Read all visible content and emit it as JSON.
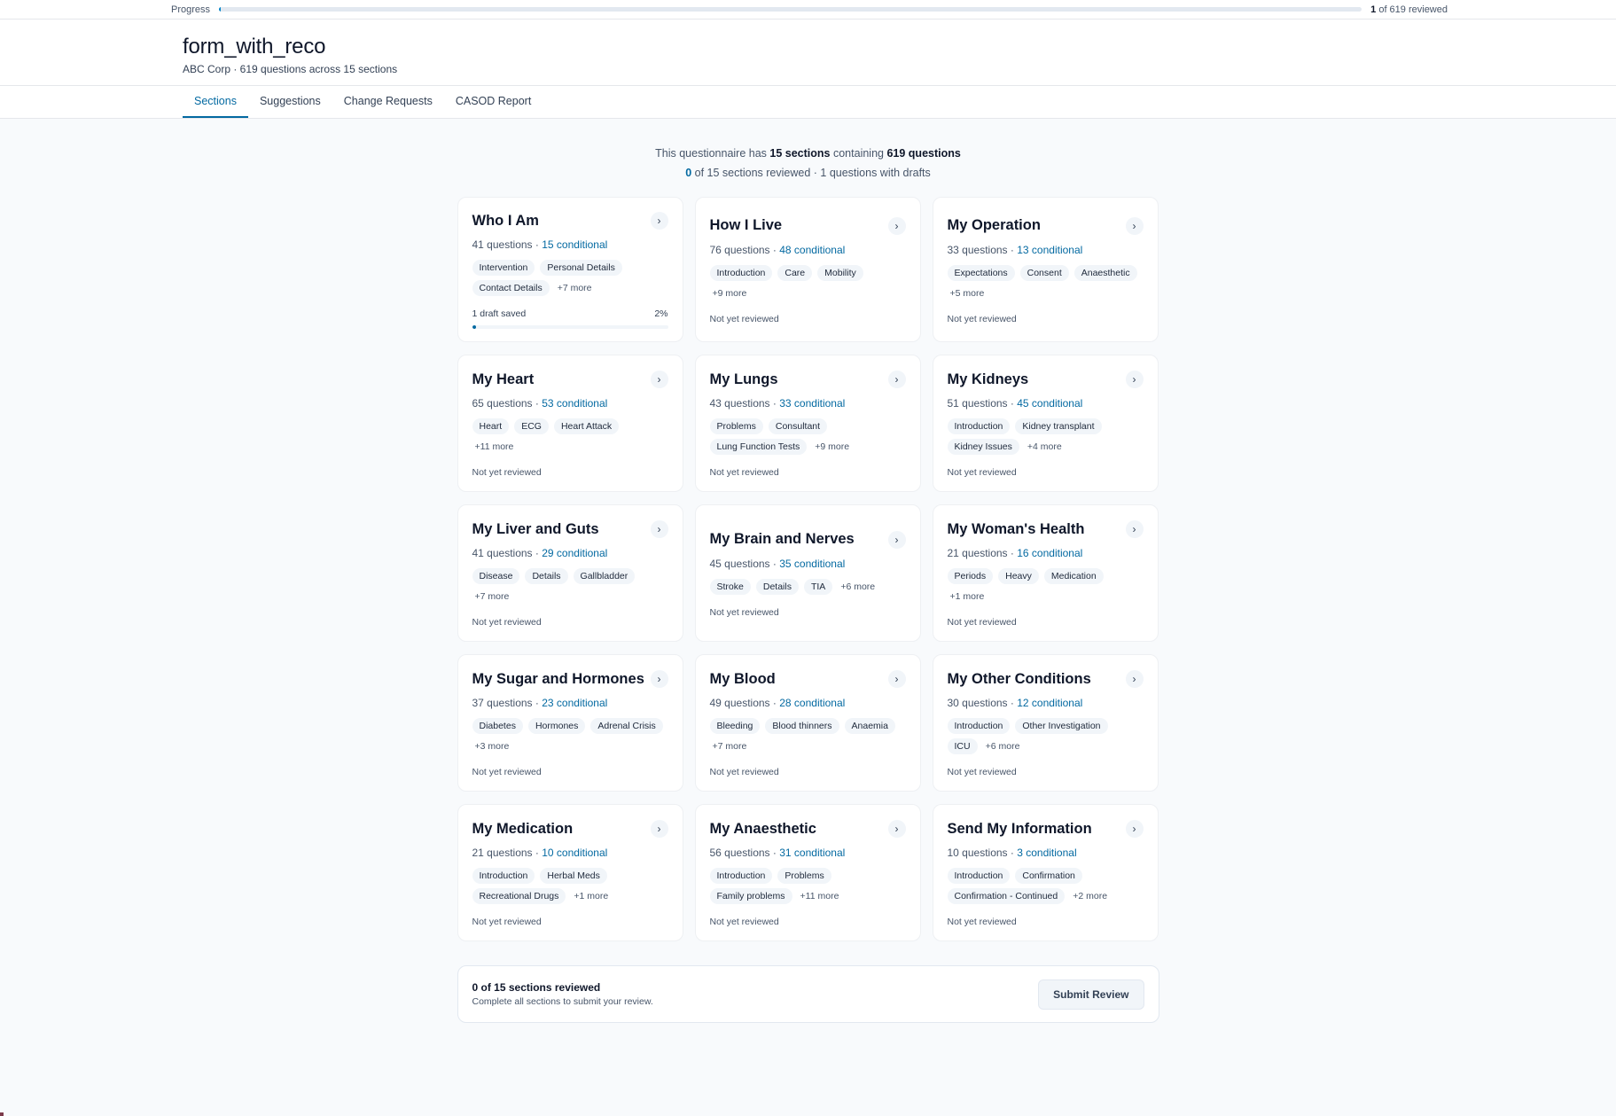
{
  "progress": {
    "label": "Progress",
    "reviewed": "1",
    "count_suffix": "of 619 reviewed",
    "fraction": 0.0016
  },
  "header": {
    "title": "form_with_reco",
    "subtitle": "ABC Corp · 619 questions across 15 sections"
  },
  "tabs": [
    {
      "label": "Sections",
      "active": true
    },
    {
      "label": "Suggestions",
      "active": false
    },
    {
      "label": "Change Requests",
      "active": false
    },
    {
      "label": "CASOD Report",
      "active": false
    }
  ],
  "summary": {
    "prefix": "This questionnaire has",
    "sections": "15 sections",
    "middle": "containing",
    "questions": "619 questions",
    "reviewed_num": "0",
    "reviewed_rest": "of 15 sections reviewed · 1 questions with drafts"
  },
  "cards": [
    {
      "title": "Who I Am",
      "questions": "41 questions",
      "conditional": "15 conditional",
      "tags": [
        "Intervention",
        "Personal Details",
        "Contact Details"
      ],
      "more": "+7 more",
      "draft": {
        "label": "1 draft saved",
        "percent": "2%",
        "fraction": 0.02
      }
    },
    {
      "title": "How I Live",
      "questions": "76 questions",
      "conditional": "48 conditional",
      "tags": [
        "Introduction",
        "Care",
        "Mobility"
      ],
      "more": "+9 more",
      "status": "Not yet reviewed"
    },
    {
      "title": "My Operation",
      "questions": "33 questions",
      "conditional": "13 conditional",
      "tags": [
        "Expectations",
        "Consent",
        "Anaesthetic"
      ],
      "more": "+5 more",
      "status": "Not yet reviewed"
    },
    {
      "title": "My Heart",
      "questions": "65 questions",
      "conditional": "53 conditional",
      "tags": [
        "Heart",
        "ECG",
        "Heart Attack"
      ],
      "more": "+11 more",
      "status": "Not yet reviewed"
    },
    {
      "title": "My Lungs",
      "questions": "43 questions",
      "conditional": "33 conditional",
      "tags": [
        "Problems",
        "Consultant",
        "Lung Function Tests"
      ],
      "more": "+9 more",
      "status": "Not yet reviewed"
    },
    {
      "title": "My Kidneys",
      "questions": "51 questions",
      "conditional": "45 conditional",
      "tags": [
        "Introduction",
        "Kidney transplant",
        "Kidney Issues"
      ],
      "more": "+4 more",
      "status": "Not yet reviewed"
    },
    {
      "title": "My Liver and Guts",
      "questions": "41 questions",
      "conditional": "29 conditional",
      "tags": [
        "Disease",
        "Details",
        "Gallbladder"
      ],
      "more": "+7 more",
      "status": "Not yet reviewed"
    },
    {
      "title": "My Brain and Nerves",
      "questions": "45 questions",
      "conditional": "35 conditional",
      "tags": [
        "Stroke",
        "Details",
        "TIA"
      ],
      "more": "+6 more",
      "status": "Not yet reviewed"
    },
    {
      "title": "My Woman's Health",
      "questions": "21 questions",
      "conditional": "16 conditional",
      "tags": [
        "Periods",
        "Heavy",
        "Medication"
      ],
      "more": "+1 more",
      "status": "Not yet reviewed"
    },
    {
      "title": "My Sugar and Hormones",
      "questions": "37 questions",
      "conditional": "23 conditional",
      "tags": [
        "Diabetes",
        "Hormones",
        "Adrenal Crisis"
      ],
      "more": "+3 more",
      "status": "Not yet reviewed"
    },
    {
      "title": "My Blood",
      "questions": "49 questions",
      "conditional": "28 conditional",
      "tags": [
        "Bleeding",
        "Blood thinners",
        "Anaemia"
      ],
      "more": "+7 more",
      "status": "Not yet reviewed"
    },
    {
      "title": "My Other Conditions",
      "questions": "30 questions",
      "conditional": "12 conditional",
      "tags": [
        "Introduction",
        "Other Investigation",
        "ICU"
      ],
      "more": "+6 more",
      "status": "Not yet reviewed"
    },
    {
      "title": "My Medication",
      "questions": "21 questions",
      "conditional": "10 conditional",
      "tags": [
        "Introduction",
        "Herbal Meds",
        "Recreational Drugs"
      ],
      "more": "+1 more",
      "status": "Not yet reviewed"
    },
    {
      "title": "My Anaesthetic",
      "questions": "56 questions",
      "conditional": "31 conditional",
      "tags": [
        "Introduction",
        "Problems",
        "Family problems"
      ],
      "more": "+11 more",
      "status": "Not yet reviewed"
    },
    {
      "title": "Send My Information",
      "questions": "10 questions",
      "conditional": "3 conditional",
      "tags": [
        "Introduction",
        "Confirmation",
        "Confirmation - Continued"
      ],
      "more": "+2 more",
      "status": "Not yet reviewed"
    }
  ],
  "footer": {
    "title": "0 of 15 sections reviewed",
    "subtitle": "Complete all sections to submit your review.",
    "submit_label": "Submit Review"
  },
  "icons": {
    "chevron": "chevron-right-icon"
  },
  "colors": {
    "accent": "#0369a1",
    "background": "#f8fafc"
  }
}
